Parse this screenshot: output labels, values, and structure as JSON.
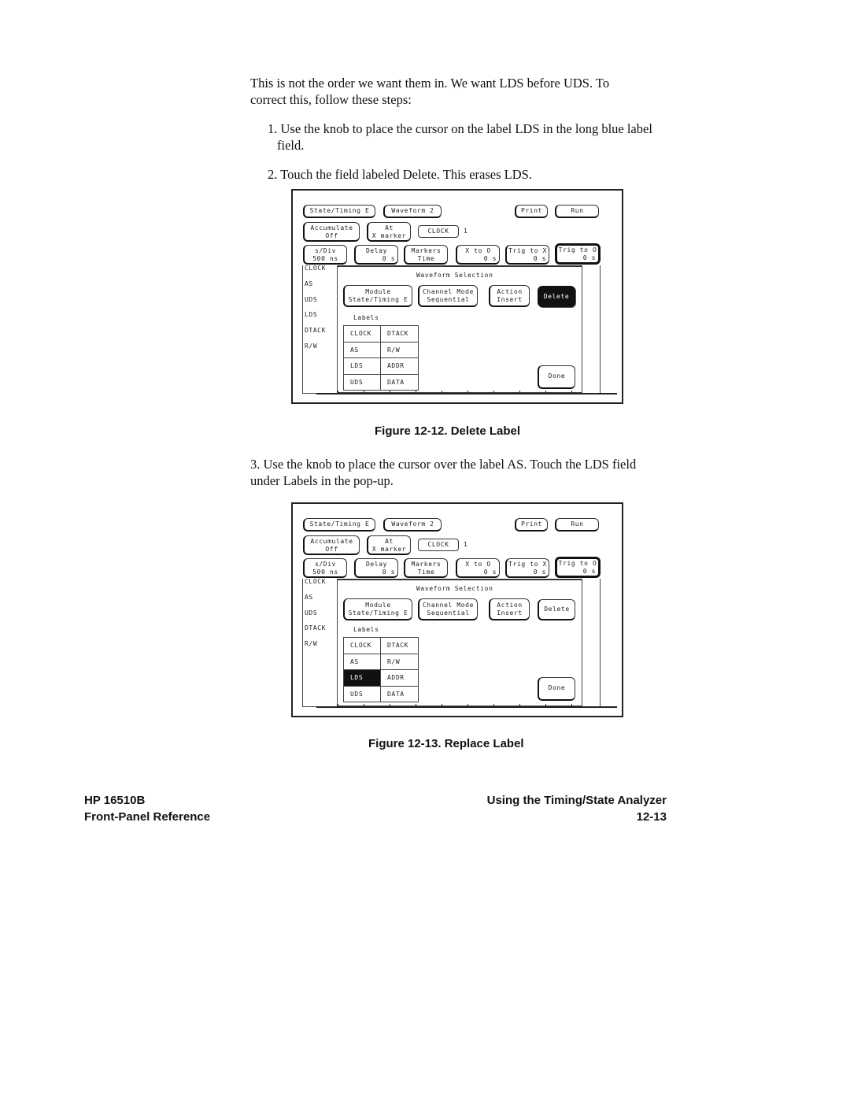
{
  "intro": {
    "paragraph": "This is not the order we want them in. We want LDS before UDS. To correct this, follow these steps:",
    "step1": "1. Use the knob to place the cursor on the label LDS in the long blue label field.",
    "step2": "2. Touch the field labeled Delete. This erases LDS."
  },
  "figure1": {
    "caption": "Figure 12-12. Delete Label",
    "top_row": {
      "module": "State/Timing E",
      "menu": "Waveform 2",
      "print": "Print",
      "run": "Run"
    },
    "second_row": {
      "acc_l1": "Accumulate",
      "acc_l2": "Off",
      "at_l1": "At",
      "at_l2": "X marker",
      "clock": "CLOCK",
      "clock_suffix": "1"
    },
    "third_row": {
      "sdiv_l1": "s/Div",
      "sdiv_l2": "500 ns",
      "delay_l1": "Delay",
      "delay_l2": "0  s",
      "markers_l1": "Markers",
      "markers_l2": "Time",
      "xto0_l1": "X to O",
      "xto0_l2": "0  s",
      "trigx_l1": "Trig to X",
      "trigx_l2": "0  s",
      "trigo_l1": "Trig to O",
      "trigo_l2": "0  s"
    },
    "sidebar_labels": [
      "CLOCK",
      "AS",
      "UDS",
      "LDS",
      "DTACK",
      "R/W"
    ],
    "popup": {
      "title": "Waveform Selection",
      "module_l1": "Module",
      "module_l2": "State/Timing E",
      "chmode_l1": "Channel Mode",
      "chmode_l2": "Sequential",
      "action_l1": "Action",
      "action_l2": "Insert",
      "delete": "Delete",
      "labels_heading": "Labels",
      "labels_grid": [
        [
          "CLOCK",
          "DTACK"
        ],
        [
          "AS",
          "R/W"
        ],
        [
          "LDS",
          "ADDR"
        ],
        [
          "UDS",
          "DATA"
        ]
      ],
      "done": "Done",
      "delete_selected": true,
      "selected_cell": null
    }
  },
  "step3": "3. Use the knob to place the cursor over the label AS.  Touch the LDS field under Labels in the pop-up.",
  "figure2": {
    "caption": "Figure 12-13. Replace Label",
    "top_row": {
      "module": "State/Timing E",
      "menu": "Waveform 2",
      "print": "Print",
      "run": "Run"
    },
    "second_row": {
      "acc_l1": "Accumulate",
      "acc_l2": "Off",
      "at_l1": "At",
      "at_l2": "X marker",
      "clock": "CLOCK",
      "clock_suffix": "1"
    },
    "third_row": {
      "sdiv_l1": "s/Div",
      "sdiv_l2": "500 ns",
      "delay_l1": "Delay",
      "delay_l2": "0  s",
      "markers_l1": "Markers",
      "markers_l2": "Time",
      "xto0_l1": "X to O",
      "xto0_l2": "0  s",
      "trigx_l1": "Trig to X",
      "trigx_l2": "0  s",
      "trigo_l1": "Trig to O",
      "trigo_l2": "0  s"
    },
    "sidebar_labels": [
      "CLOCK",
      "AS",
      "UDS",
      "DTACK",
      "R/W"
    ],
    "popup": {
      "title": "Waveform Selection",
      "module_l1": "Module",
      "module_l2": "State/Timing E",
      "chmode_l1": "Channel Mode",
      "chmode_l2": "Sequential",
      "action_l1": "Action",
      "action_l2": "Insert",
      "delete": "Delete",
      "labels_heading": "Labels",
      "labels_grid": [
        [
          "CLOCK",
          "DTACK"
        ],
        [
          "AS",
          "R/W"
        ],
        [
          "LDS",
          "ADDR"
        ],
        [
          "UDS",
          "DATA"
        ]
      ],
      "done": "Done",
      "delete_selected": false,
      "selected_cell": "LDS"
    }
  },
  "footer": {
    "left_l1": "HP 16510B",
    "left_l2": "Front-Panel Reference",
    "right_l1": "Using the Timing/State Analyzer",
    "right_l2": "12-13"
  }
}
